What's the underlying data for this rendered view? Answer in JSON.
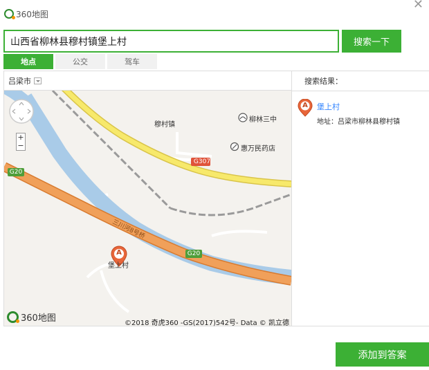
{
  "header": {
    "logo_text": "360地图",
    "close_icon": "close-icon"
  },
  "search": {
    "value": "山西省柳林县穆村镇堡上村",
    "button_label": "搜索一下"
  },
  "tabs": [
    {
      "label": "地点",
      "active": true
    },
    {
      "label": "公交",
      "active": false
    },
    {
      "label": "驾车",
      "active": false
    }
  ],
  "map": {
    "city": "吕梁市",
    "labels": {
      "town": "穆村镇",
      "school": "柳林三中",
      "pharmacy": "惠万民药店",
      "road_g307": "G307",
      "road_g20_left": "G20",
      "road_g20_right": "G20",
      "bridge": "三川河8号桥",
      "village": "堡上村",
      "marker_letter": "A"
    },
    "zoom": {
      "in": "+",
      "out": "−"
    },
    "logo_text": "360地图",
    "copyright": "©2018 奇虎360 -GS(2017)542号- Data © 凯立德"
  },
  "results": {
    "header": "搜索结果：",
    "items": [
      {
        "marker": "A",
        "title": "堡上村",
        "address": "地址：吕梁市柳林县穆村镇"
      }
    ]
  },
  "footer": {
    "add_button": "添加到答案"
  },
  "colors": {
    "accent": "#3cb035",
    "road_yellow": "#f7e96b",
    "highway": "#f0a05a",
    "river": "#a9cbe8",
    "marker": "#e8663a",
    "link": "#3385ff"
  }
}
